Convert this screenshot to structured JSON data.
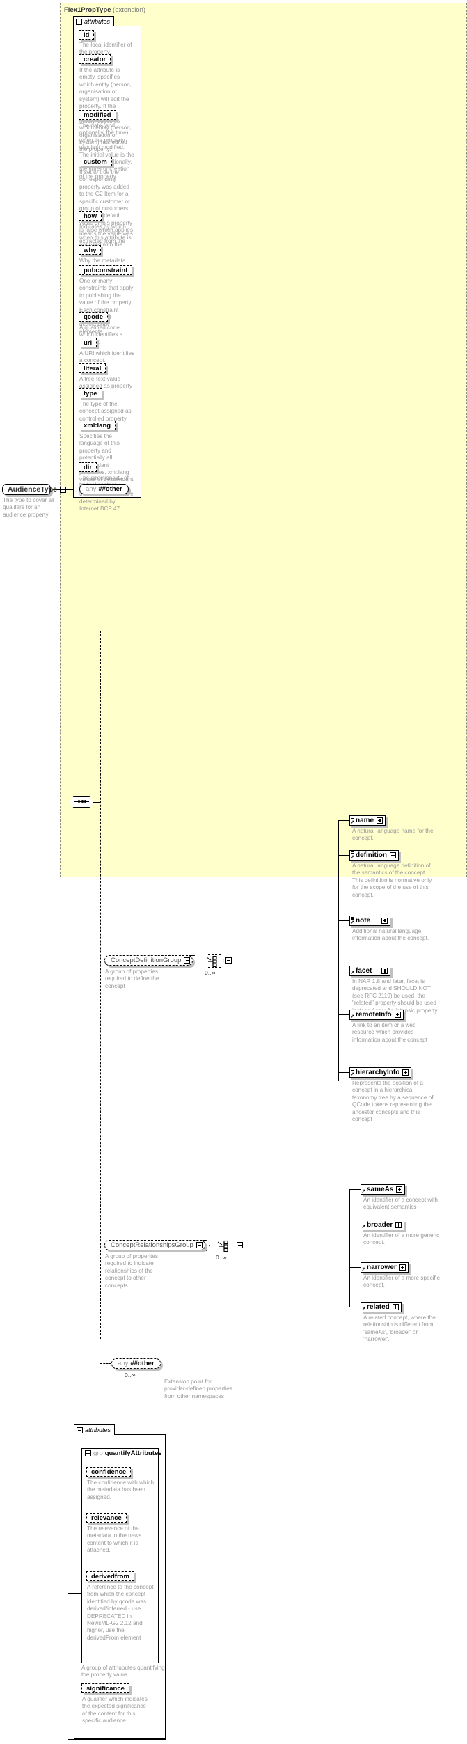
{
  "diagram": {
    "title": "Flex1PropType",
    "title_suffix": "(extension)",
    "attributes_label": "attributes",
    "group_keyword": "grp",
    "occurs_zero_to_many": "0..∞"
  },
  "root_type": {
    "name": "AudienceType",
    "doc": "The type to cover all qualifers for an audience property"
  },
  "extension_attributes": [
    {
      "name": "id",
      "doc": "The local identifier of the property."
    },
    {
      "name": "creator",
      "doc": "If the attribute is empty, specifies which entity (person, organisation or system) will edit the property. If the attribute is non-empty, specifies which entity (person, organisation or system) has edited the property."
    },
    {
      "name": "modified",
      "doc": "The date (and, optionally, the time) when the property was last modified. The initial value is the date (and, optionally, the time) of creation of the property."
    },
    {
      "name": "custom",
      "doc": "If set to true the corresponding property was added to the G2 Item for a specific customer or group of customers only. The default value of this property is false which applies when this attribute is not used with the property."
    },
    {
      "name": "how",
      "doc": "Indicates by which means the value was extracted from the content."
    },
    {
      "name": "why",
      "doc": "Why the metadata has been included."
    },
    {
      "name": "pubconstraint",
      "doc": "One or many constraints that apply to publishing the value of the property. Each constraint applies to all descendant elements."
    },
    {
      "name": "qcode",
      "doc": "A qualified code which identifies a concept."
    },
    {
      "name": "uri",
      "doc": "A URI which identifies a concept."
    },
    {
      "name": "literal",
      "doc": "A free-text value assigned as property value."
    },
    {
      "name": "type",
      "doc": "The type of the concept assigned as controlled property value."
    },
    {
      "name": "xml:lang",
      "doc": "Specifies the language of this property and potentially all descendant properties. xml:lang values of descendant properties override this value. Values are determined by Internet BCP 47."
    },
    {
      "name": "dir",
      "doc": "The directionality of textual content."
    }
  ],
  "extension_any": {
    "keyword": "any",
    "value": "##other"
  },
  "concept_definition_group": {
    "name": "ConceptDefinitionGroup",
    "doc": "A group of properties required to define the concept",
    "occurs": "0..∞",
    "elements": [
      {
        "name": "name",
        "doc": "A natural language name for the concept."
      },
      {
        "name": "definition",
        "doc": "A natural language definition of the semantics of the concept. This definition is normative only for the scope of the use of this concept."
      },
      {
        "name": "note",
        "doc": "Additional natural language information about the concept."
      },
      {
        "name": "facet",
        "doc": "In NAR 1.8 and later, facet is deprecated and SHOULD NOT (see RFC 2119) be used, the \"related\" property should be used instead (was: An intrinsic property of the concept.)"
      },
      {
        "name": "remoteInfo",
        "doc": "A link to an item or a web resource which provides information about the concept"
      },
      {
        "name": "hierarchyInfo",
        "doc": "Represents the position of a concept in a hierarchical taxonomy tree by a sequence of QCode tokens representing the ancestor concepts and this concept"
      }
    ]
  },
  "concept_relationships_group": {
    "name": "ConceptRelationshipsGroup",
    "doc": "A group of properites required to indicate relationships of the concept to other concepts",
    "occurs": "0..∞",
    "elements": [
      {
        "name": "sameAs",
        "doc": "An identifier of a concept with equivalent semantics"
      },
      {
        "name": "broader",
        "doc": "An identifier of a more generic concept."
      },
      {
        "name": "narrower",
        "doc": "An identifier of a more specific concept."
      },
      {
        "name": "related",
        "doc": "A related concept, where the relationship is different from 'sameAs', 'broader' or 'narrower'."
      }
    ]
  },
  "extension_point": {
    "keyword": "any",
    "value": "##other",
    "occurs": "0..∞",
    "doc": "Extension point for provider-defined properties from other namespaces"
  },
  "bottom_attributes": {
    "attributes_label": "attributes",
    "group_keyword": "grp",
    "group_name": "quantifyAttributes",
    "group_doc": "A group of attriubutes quantifying the property value",
    "items": [
      {
        "name": "confidence",
        "doc": "The confidence with which the metadata has been assigned."
      },
      {
        "name": "relevance",
        "doc": "The relevance of the metadata to the news content to which it is attached."
      },
      {
        "name": "derivedfrom",
        "doc": "A reference to the concept from which the concept identified by qcode was derived/inferred - use DEPRECATED in NewsML-G2 2.12 and higher, use the derivedFrom element"
      }
    ],
    "significance": {
      "name": "significance",
      "doc": "A qualifier which indicates the expected significance of the content for this specific audience."
    }
  },
  "colors": {
    "panel_bg": "#ffffcc",
    "doc_text": "#999999",
    "border": "#000000",
    "shadow": "#c0c0c0"
  }
}
